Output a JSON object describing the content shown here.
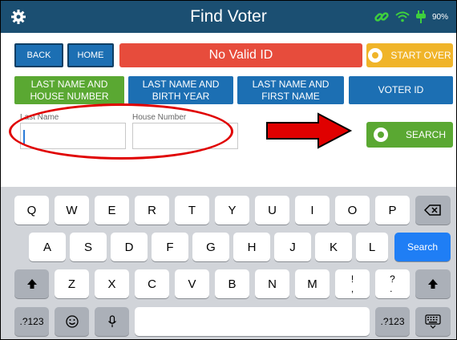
{
  "header": {
    "title": "Find Voter",
    "battery": "90%"
  },
  "nav": {
    "back": "BACK",
    "home": "HOME",
    "id_status": "No Valid ID",
    "start_over": "START OVER"
  },
  "tabs": [
    {
      "line1": "LAST NAME AND",
      "line2": "HOUSE NUMBER"
    },
    {
      "line1": "LAST NAME AND",
      "line2": "BIRTH YEAR"
    },
    {
      "line1": "LAST NAME AND",
      "line2": "FIRST NAME"
    },
    {
      "line1": "VOTER ID",
      "line2": ""
    }
  ],
  "form": {
    "last_name_label": "Last Name",
    "last_name_value": "",
    "house_number_label": "House Number",
    "house_number_value": "",
    "search_label": "SEARCH"
  },
  "keyboard": {
    "row1": [
      "Q",
      "W",
      "E",
      "R",
      "T",
      "Y",
      "U",
      "I",
      "O",
      "P"
    ],
    "row2": [
      "A",
      "S",
      "D",
      "F",
      "G",
      "H",
      "J",
      "K",
      "L"
    ],
    "row3": [
      "Z",
      "X",
      "C",
      "V",
      "B",
      "N",
      "M",
      "!\n,",
      "?\n."
    ],
    "search_key": "Search",
    "numbers_key": ".?123"
  },
  "colors": {
    "header": "#1b4f72",
    "blue": "#1c6fb3",
    "green": "#5aa832",
    "red": "#e74c3c",
    "orange": "#f0b429",
    "annotation": "#e00000"
  }
}
